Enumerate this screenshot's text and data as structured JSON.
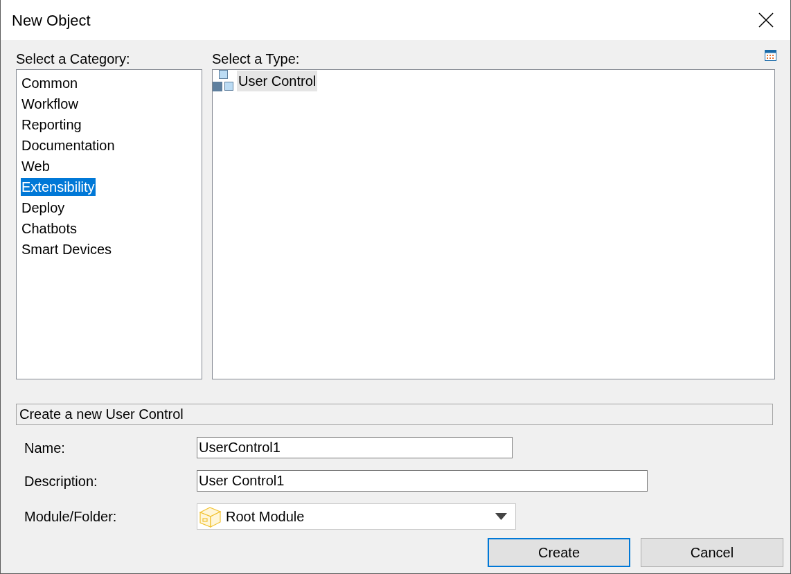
{
  "window": {
    "title": "New Object"
  },
  "categories": {
    "label": "Select a Category:",
    "items": [
      {
        "label": "Common",
        "selected": false
      },
      {
        "label": "Workflow",
        "selected": false
      },
      {
        "label": "Reporting",
        "selected": false
      },
      {
        "label": "Documentation",
        "selected": false
      },
      {
        "label": "Web",
        "selected": false
      },
      {
        "label": "Extensibility",
        "selected": true
      },
      {
        "label": "Deploy",
        "selected": false
      },
      {
        "label": "Chatbots",
        "selected": false
      },
      {
        "label": "Smart Devices",
        "selected": false
      }
    ]
  },
  "types": {
    "label": "Select a Type:",
    "items": [
      {
        "label": "User Control",
        "selected": true
      }
    ]
  },
  "description": "Create a new User Control",
  "fields": [
    {
      "kind": "text",
      "label": "Name:",
      "value": "UserControl1"
    },
    {
      "kind": "text",
      "label": "Description:",
      "value": "User Control1"
    },
    {
      "kind": "dropdown",
      "label": "Module/Folder:",
      "value": "Root Module"
    }
  ],
  "buttons": [
    {
      "label": "Create",
      "default": true
    },
    {
      "label": "Cancel",
      "default": false
    }
  ]
}
